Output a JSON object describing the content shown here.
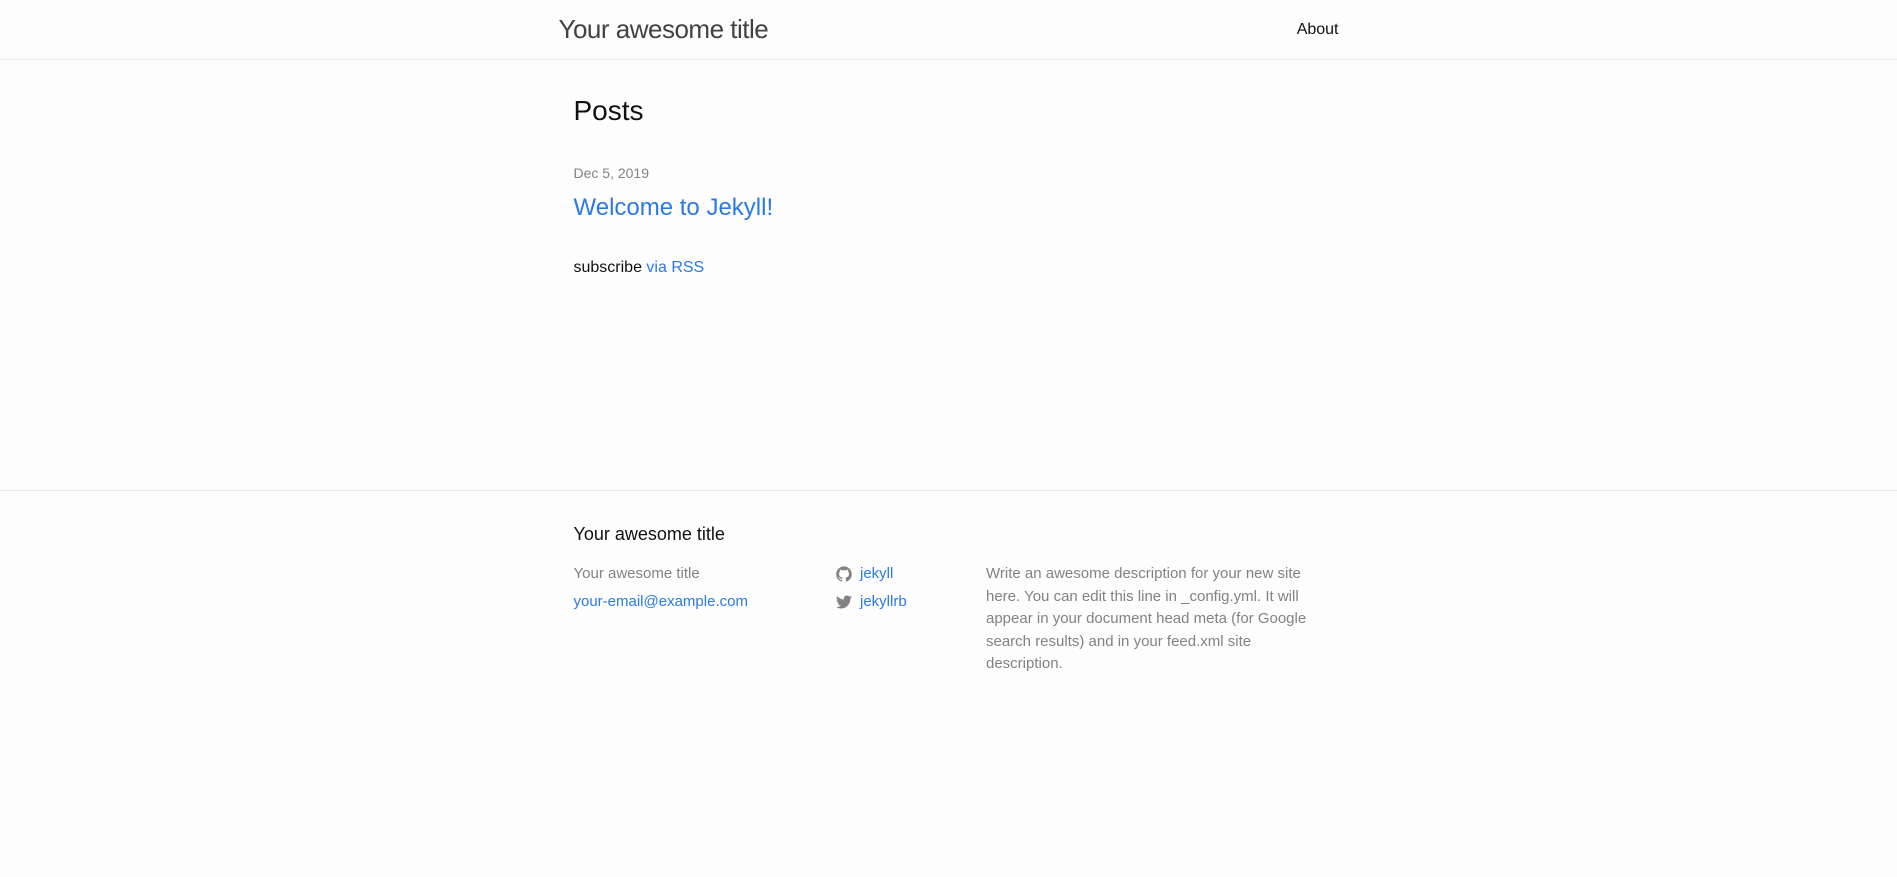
{
  "header": {
    "site_title": "Your awesome title",
    "nav": {
      "about": "About"
    }
  },
  "main": {
    "heading": "Posts",
    "posts": [
      {
        "date": "Dec 5, 2019",
        "title": "Welcome to Jekyll!"
      }
    ],
    "subscribe_text": "subscribe ",
    "subscribe_link": "via RSS"
  },
  "footer": {
    "heading": "Your awesome title",
    "contact": {
      "name": "Your awesome title",
      "email": "your-email@example.com"
    },
    "social": {
      "github": "jekyll",
      "twitter": "jekyllrb"
    },
    "description": "Write an awesome description for your new site here. You can edit this line in _config.yml. It will appear in your document head meta (for Google search results) and in your feed.xml site description."
  }
}
